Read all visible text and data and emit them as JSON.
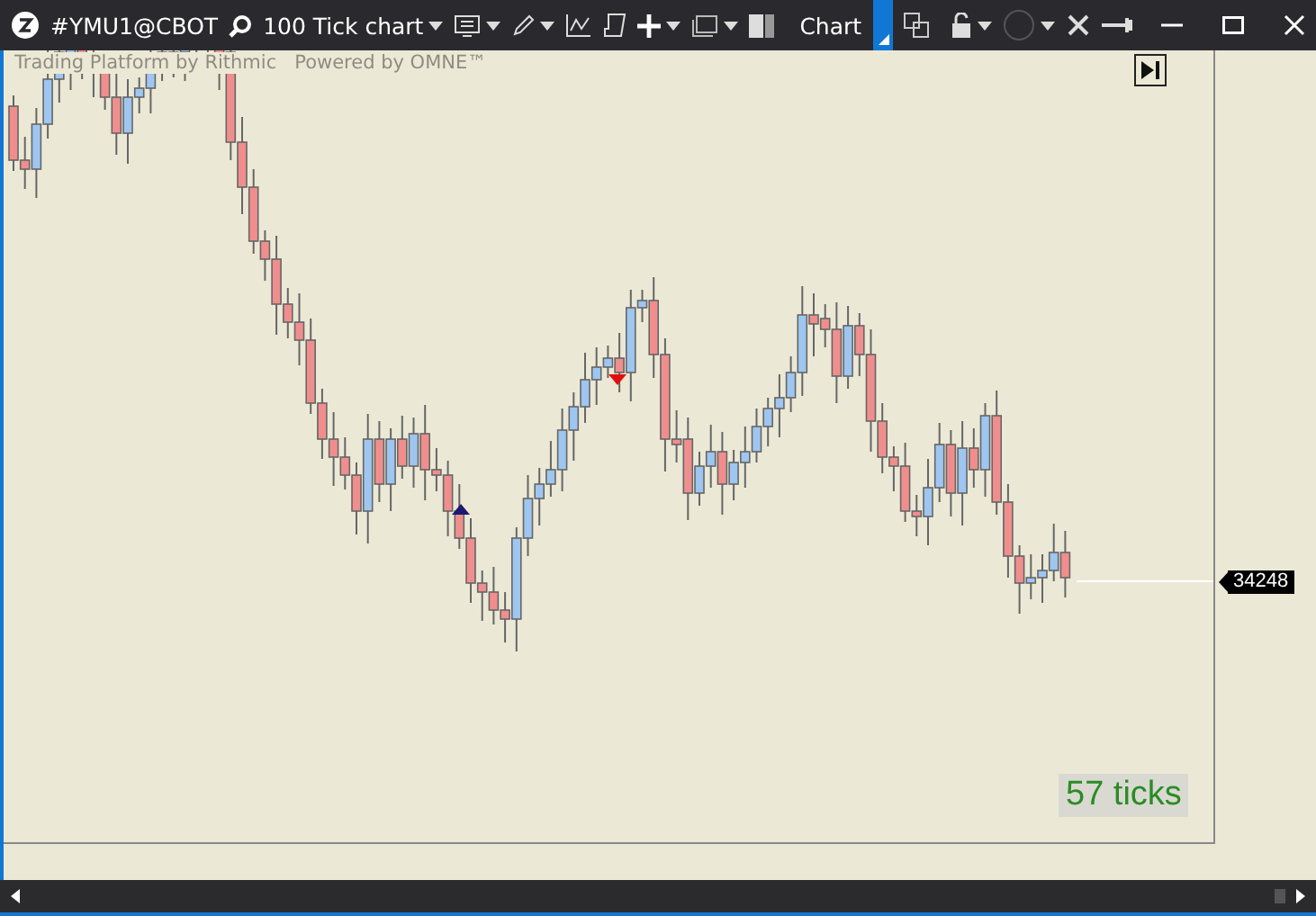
{
  "window": {
    "symbol": "#YMU1@CBOT",
    "chart_type": "100 Tick chart",
    "title": "Chart"
  },
  "chart": {
    "branding": "Trading Platform by Rithmic",
    "powered_by": "Powered by OMNE™",
    "last_price": "34248",
    "tick_counter": "57 ticks"
  }
}
